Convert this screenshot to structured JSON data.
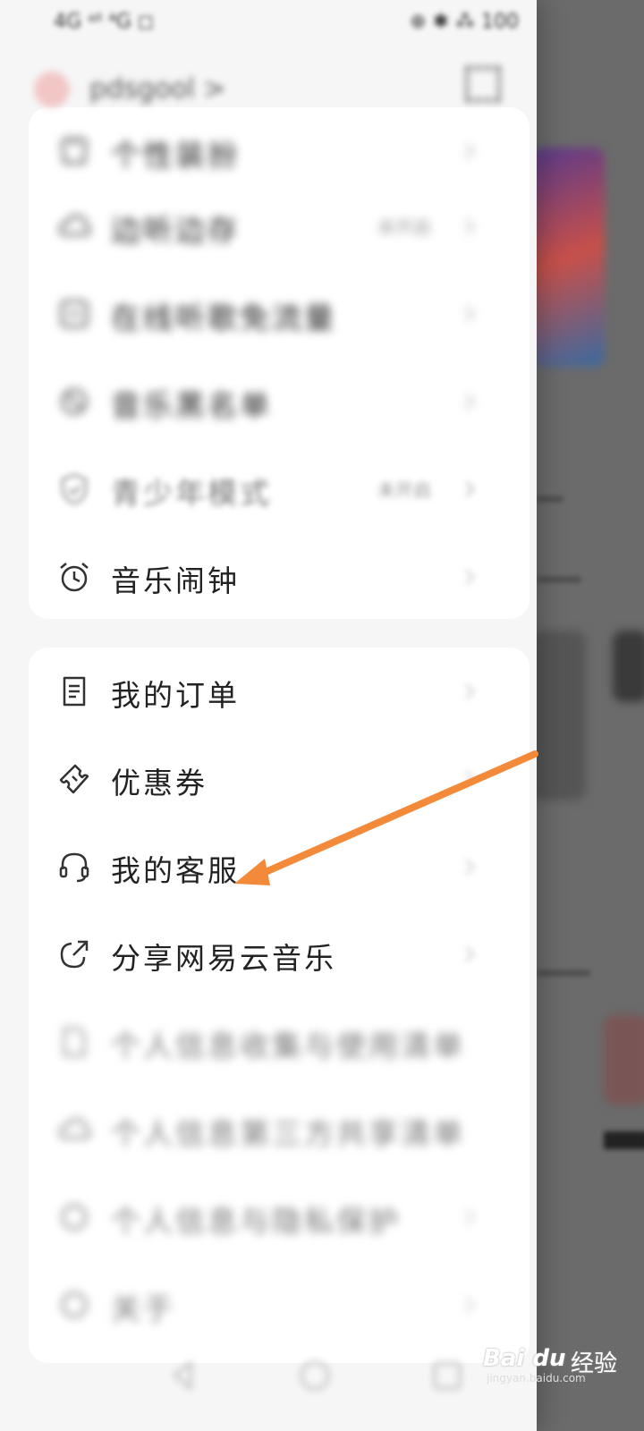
{
  "status_bar": {
    "left": "4G ᵃˡˡ ⁴G ◻",
    "right": "⊕ ✱ ⁂ 100"
  },
  "user": {
    "name": "pdsgool >"
  },
  "menu_top": [
    {
      "label": "个性装扮",
      "value": ""
    },
    {
      "label": "边听边存",
      "value": "未开启"
    },
    {
      "label": "在线听歌免流量",
      "value": ""
    },
    {
      "label": "音乐黑名单",
      "value": ""
    },
    {
      "label": "青少年模式",
      "value": "未开启"
    },
    {
      "label": "音乐闹钟",
      "value": ""
    }
  ],
  "menu_bottom": [
    {
      "label": "我的订单"
    },
    {
      "label": "优惠券"
    },
    {
      "label": "我的客服"
    },
    {
      "label": "分享网易云音乐"
    },
    {
      "label": "个人信息收集与使用清单"
    },
    {
      "label": "个人信息第三方共享清单"
    },
    {
      "label": "个人信息与隐私保护"
    },
    {
      "label": "关于"
    }
  ],
  "watermark": {
    "logo": "Bai du",
    "text": "经验",
    "url": "jingyan.baidu.com"
  },
  "colors": {
    "arrow": "#f28a3a",
    "backdrop": "#6b6b6b"
  }
}
